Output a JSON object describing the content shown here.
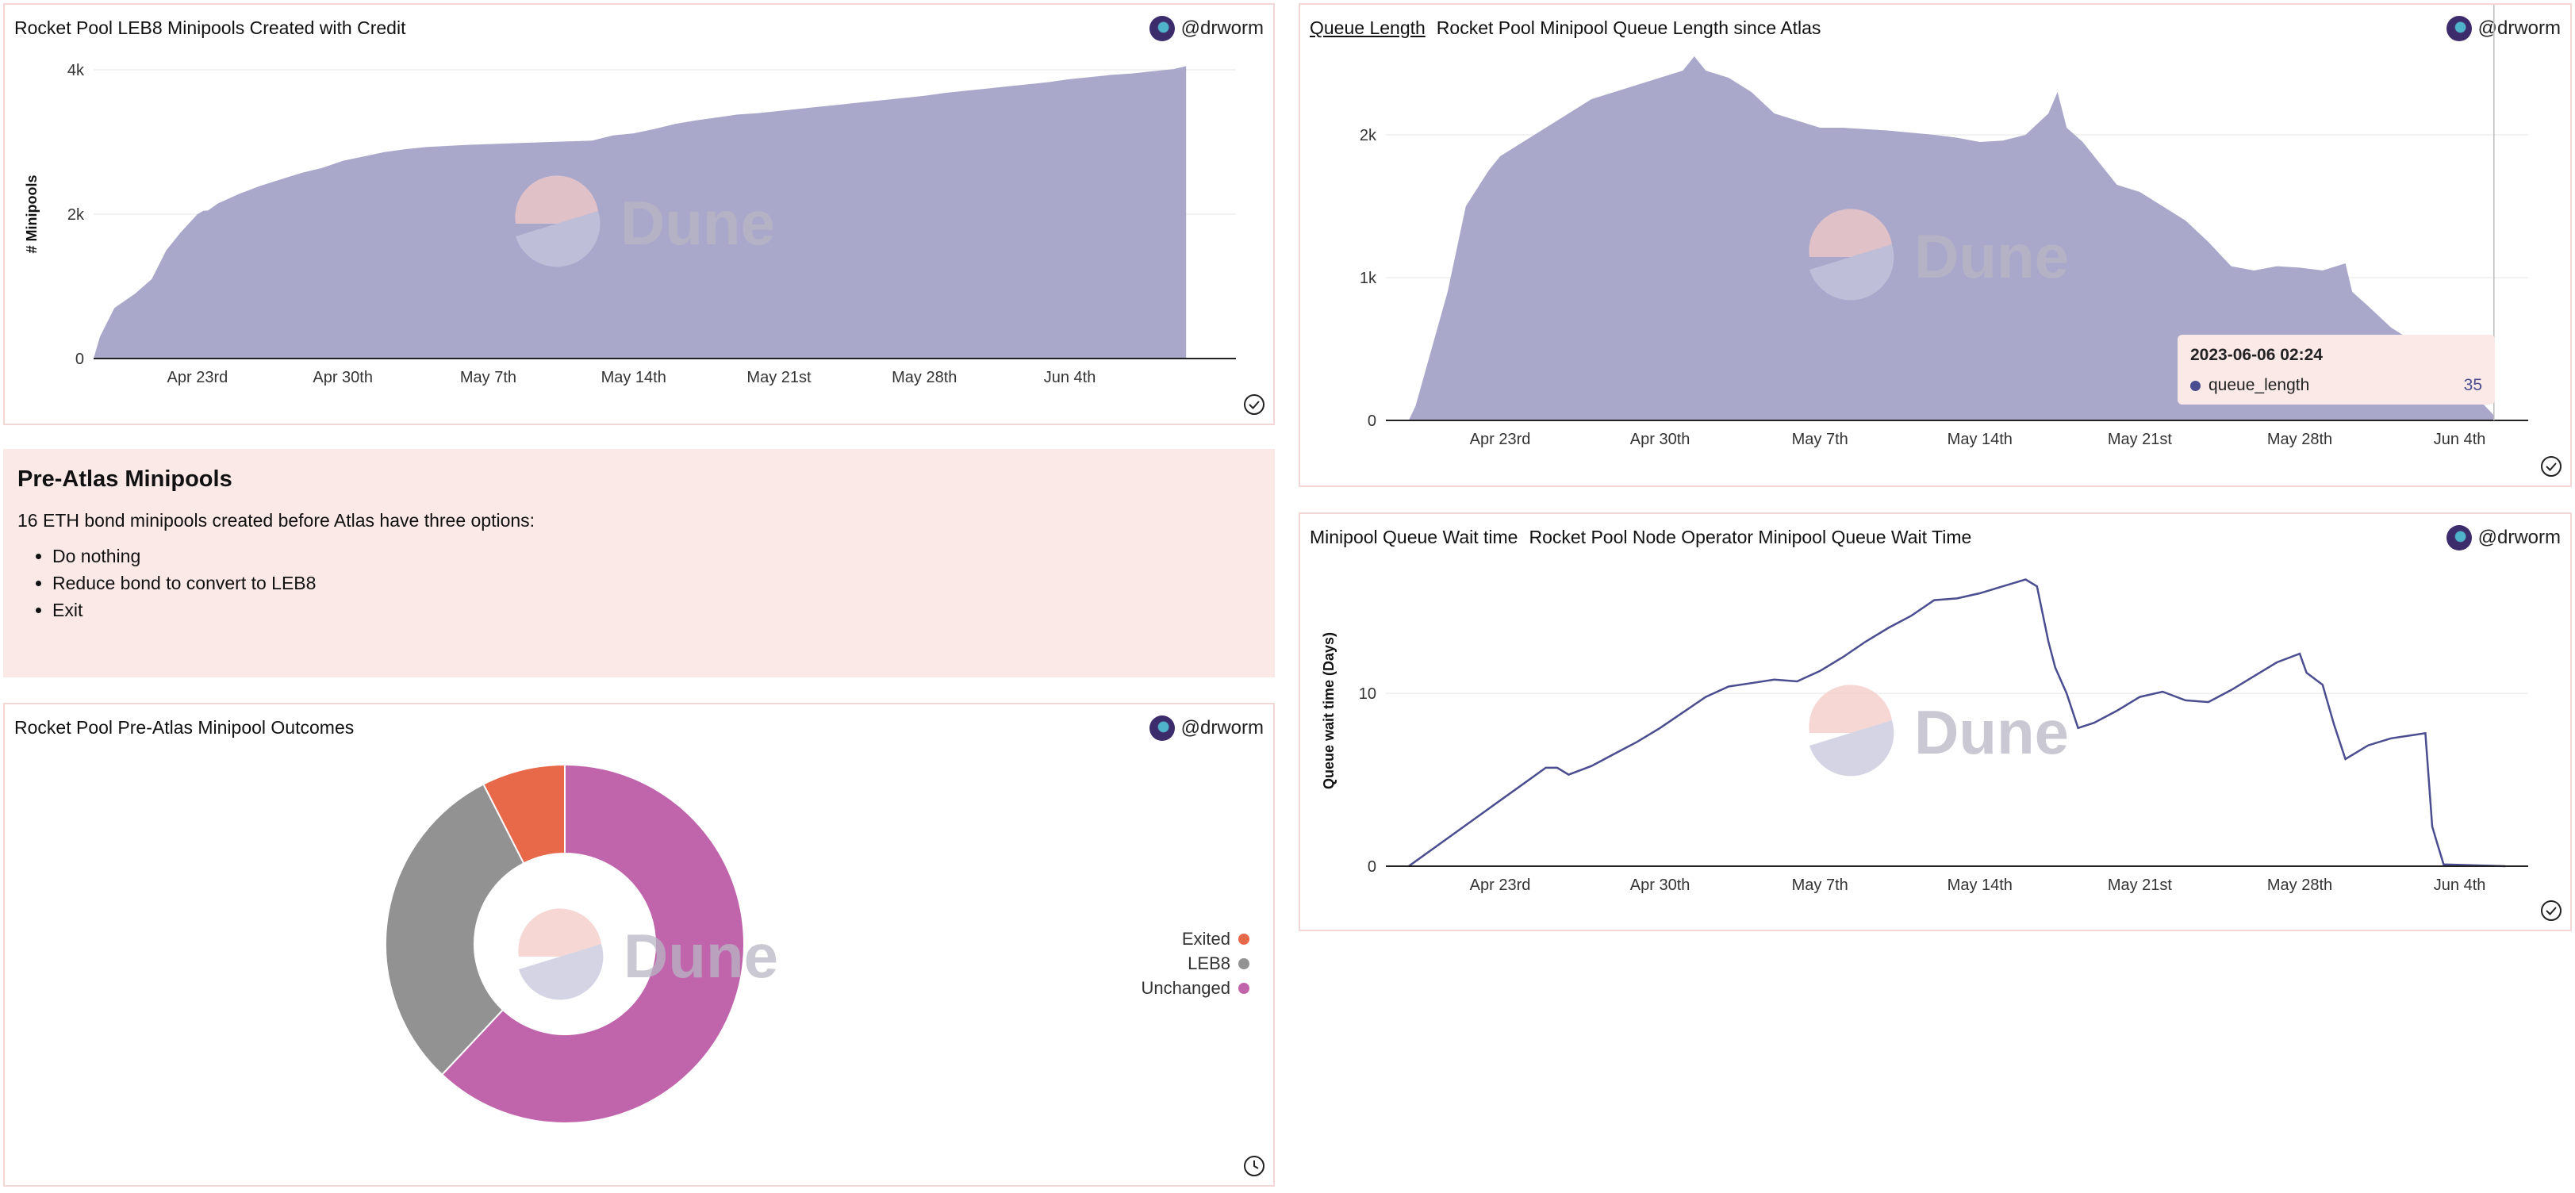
{
  "colors": {
    "area": "#a9a8cb",
    "line": "#4a4d8f",
    "tooltip_bg": "#fbe9e8",
    "tooltip_dot": "#4a4d8f",
    "exited": "#e8694a",
    "leb8": "#929292",
    "unchanged": "#c064ac",
    "watermark_text": "#b9b6c3"
  },
  "watermark": "Dune",
  "cards": {
    "leb8": {
      "title": "Rocket Pool LEB8 Minipools Created with Credit",
      "author": "@drworm",
      "status_icon": "check-circle-icon"
    },
    "queue_length": {
      "link_title": "Queue Length",
      "title": "Rocket Pool Minipool Queue Length since Atlas",
      "author": "@drworm",
      "status_icon": "check-circle-icon"
    },
    "wait_time": {
      "link_title": "Minipool Queue Wait time",
      "title": "Rocket Pool Node Operator Minipool Queue Wait Time",
      "author": "@drworm",
      "status_icon": "check-circle-icon"
    },
    "outcomes": {
      "title": "Rocket Pool Pre-Atlas Minipool Outcomes",
      "author": "@drworm",
      "status_icon": "clock-icon"
    }
  },
  "note": {
    "heading": "Pre-Atlas Minipools",
    "text": "16 ETH bond minipools created before Atlas have three options:",
    "items": [
      "Do nothing",
      "Reduce bond to convert to LEB8",
      "Exit"
    ]
  },
  "tooltip": {
    "date": "2023-06-06 02:24",
    "series": "queue_length",
    "value": "35"
  },
  "chart_data": [
    {
      "id": "leb8",
      "type": "area",
      "title": "Rocket Pool LEB8 Minipools Created with Credit",
      "ylabel": "# Minipools",
      "ylim": [
        0,
        4000
      ],
      "yticks": [
        {
          "v": 0,
          "label": "0"
        },
        {
          "v": 2000,
          "label": "2k"
        },
        {
          "v": 4000,
          "label": "4k"
        }
      ],
      "xlim": [
        0,
        55
      ],
      "xticks": [
        {
          "v": 5,
          "label": "Apr 23rd"
        },
        {
          "v": 12,
          "label": "Apr 30th"
        },
        {
          "v": 19,
          "label": "May 7th"
        },
        {
          "v": 26,
          "label": "May 14th"
        },
        {
          "v": 33,
          "label": "May 21st"
        },
        {
          "v": 40,
          "label": "May 28th"
        },
        {
          "v": 47,
          "label": "Jun 4th"
        }
      ],
      "points": [
        [
          0,
          0
        ],
        [
          0.3,
          300
        ],
        [
          1,
          700
        ],
        [
          2,
          900
        ],
        [
          2.8,
          1100
        ],
        [
          3.5,
          1500
        ],
        [
          4.2,
          1750
        ],
        [
          5,
          2000
        ],
        [
          5.3,
          2050
        ],
        [
          5.5,
          2050
        ],
        [
          6,
          2150
        ],
        [
          7,
          2280
        ],
        [
          8,
          2390
        ],
        [
          9,
          2480
        ],
        [
          10,
          2570
        ],
        [
          11,
          2640
        ],
        [
          12,
          2740
        ],
        [
          13,
          2800
        ],
        [
          14,
          2860
        ],
        [
          15,
          2900
        ],
        [
          16,
          2930
        ],
        [
          18,
          2960
        ],
        [
          20,
          2980
        ],
        [
          22,
          3000
        ],
        [
          24,
          3020
        ],
        [
          25,
          3090
        ],
        [
          26,
          3120
        ],
        [
          27,
          3180
        ],
        [
          28,
          3250
        ],
        [
          29,
          3300
        ],
        [
          30,
          3340
        ],
        [
          31,
          3380
        ],
        [
          32,
          3400
        ],
        [
          33,
          3430
        ],
        [
          34,
          3460
        ],
        [
          35,
          3490
        ],
        [
          36,
          3520
        ],
        [
          37,
          3550
        ],
        [
          38,
          3580
        ],
        [
          39,
          3610
        ],
        [
          40,
          3640
        ],
        [
          41,
          3680
        ],
        [
          42,
          3710
        ],
        [
          43,
          3740
        ],
        [
          44,
          3770
        ],
        [
          45,
          3800
        ],
        [
          46,
          3830
        ],
        [
          47,
          3870
        ],
        [
          48,
          3900
        ],
        [
          49,
          3930
        ],
        [
          50,
          3950
        ],
        [
          51,
          3980
        ],
        [
          52,
          4010
        ],
        [
          52.6,
          4050
        ],
        [
          52.6,
          0
        ]
      ],
      "xticks_note": ""
    },
    {
      "id": "queue_length",
      "type": "area",
      "title": "Rocket Pool Minipool Queue Length since Atlas",
      "ylabel": "",
      "series": [
        {
          "name": "queue_length"
        }
      ],
      "ylim": [
        0,
        2600
      ],
      "yticks": [
        {
          "v": 0,
          "label": "0"
        },
        {
          "v": 1000,
          "label": "1k"
        },
        {
          "v": 2000,
          "label": "2k"
        }
      ],
      "xlim": [
        0,
        50
      ],
      "xticks": [
        {
          "v": 5,
          "label": "Apr 23rd"
        },
        {
          "v": 12,
          "label": "Apr 30th"
        },
        {
          "v": 19,
          "label": "May 7th"
        },
        {
          "v": 26,
          "label": "May 14th"
        },
        {
          "v": 33,
          "label": "May 21st"
        },
        {
          "v": 40,
          "label": "May 28th"
        },
        {
          "v": 47,
          "label": "Jun 4th"
        }
      ],
      "points": [
        [
          1,
          0
        ],
        [
          1.3,
          100
        ],
        [
          2,
          500
        ],
        [
          2.7,
          900
        ],
        [
          3.5,
          1500
        ],
        [
          4.5,
          1750
        ],
        [
          5,
          1850
        ],
        [
          6,
          1950
        ],
        [
          7,
          2050
        ],
        [
          8,
          2150
        ],
        [
          9,
          2250
        ],
        [
          10,
          2300
        ],
        [
          11,
          2350
        ],
        [
          12,
          2400
        ],
        [
          13,
          2450
        ],
        [
          13.5,
          2550
        ],
        [
          14,
          2450
        ],
        [
          15,
          2400
        ],
        [
          16,
          2300
        ],
        [
          17,
          2150
        ],
        [
          18,
          2100
        ],
        [
          19,
          2050
        ],
        [
          20,
          2050
        ],
        [
          22,
          2030
        ],
        [
          24,
          2000
        ],
        [
          25,
          1980
        ],
        [
          26,
          1950
        ],
        [
          27,
          1960
        ],
        [
          28,
          2000
        ],
        [
          29,
          2150
        ],
        [
          29.4,
          2300
        ],
        [
          29.8,
          2050
        ],
        [
          30.5,
          1950
        ],
        [
          31,
          1850
        ],
        [
          32,
          1650
        ],
        [
          33,
          1600
        ],
        [
          34,
          1500
        ],
        [
          35,
          1400
        ],
        [
          36,
          1250
        ],
        [
          37,
          1080
        ],
        [
          38,
          1050
        ],
        [
          39,
          1080
        ],
        [
          40,
          1070
        ],
        [
          41,
          1050
        ],
        [
          42,
          1100
        ],
        [
          42.3,
          900
        ],
        [
          43,
          800
        ],
        [
          44,
          650
        ],
        [
          45,
          550
        ],
        [
          46,
          350
        ],
        [
          47,
          200
        ],
        [
          48,
          120
        ],
        [
          48.5,
          35
        ],
        [
          48.5,
          0
        ]
      ],
      "annotation": {
        "x": 48.5,
        "date": "2023-06-06 02:24",
        "value": 35
      }
    },
    {
      "id": "wait_time",
      "type": "line",
      "title": "Rocket Pool Node Operator Minipool Queue Wait Time",
      "ylabel": "Queue wait time (Days)",
      "ylim": [
        0,
        18
      ],
      "yticks": [
        {
          "v": 0,
          "label": "0"
        },
        {
          "v": 10,
          "label": "10"
        }
      ],
      "xlim": [
        0,
        50
      ],
      "xticks": [
        {
          "v": 5,
          "label": "Apr 23rd"
        },
        {
          "v": 12,
          "label": "Apr 30th"
        },
        {
          "v": 19,
          "label": "May 7th"
        },
        {
          "v": 26,
          "label": "May 14th"
        },
        {
          "v": 33,
          "label": "May 21st"
        },
        {
          "v": 40,
          "label": "May 28th"
        },
        {
          "v": 47,
          "label": "Jun 4th"
        }
      ],
      "points": [
        [
          1,
          0
        ],
        [
          3,
          1.9
        ],
        [
          5,
          3.8
        ],
        [
          7,
          5.7
        ],
        [
          7.5,
          5.7
        ],
        [
          8,
          5.3
        ],
        [
          9,
          5.8
        ],
        [
          10,
          6.5
        ],
        [
          11,
          7.2
        ],
        [
          12,
          8
        ],
        [
          13,
          8.9
        ],
        [
          14,
          9.8
        ],
        [
          15,
          10.4
        ],
        [
          16,
          10.6
        ],
        [
          17,
          10.8
        ],
        [
          18,
          10.7
        ],
        [
          19,
          11.3
        ],
        [
          20,
          12.1
        ],
        [
          21,
          13
        ],
        [
          22,
          13.8
        ],
        [
          23,
          14.5
        ],
        [
          24,
          15.4
        ],
        [
          25,
          15.5
        ],
        [
          26,
          15.8
        ],
        [
          27,
          16.2
        ],
        [
          28,
          16.6
        ],
        [
          28.5,
          16.2
        ],
        [
          29,
          13
        ],
        [
          29.3,
          11.5
        ],
        [
          29.8,
          10
        ],
        [
          30.3,
          8
        ],
        [
          31,
          8.3
        ],
        [
          32,
          9
        ],
        [
          33,
          9.8
        ],
        [
          34,
          10.1
        ],
        [
          35,
          9.6
        ],
        [
          36,
          9.5
        ],
        [
          37,
          10.2
        ],
        [
          38,
          11
        ],
        [
          39,
          11.8
        ],
        [
          40,
          12.3
        ],
        [
          40.3,
          11.2
        ],
        [
          41,
          10.5
        ],
        [
          41.5,
          8.2
        ],
        [
          42,
          6.2
        ],
        [
          43,
          7
        ],
        [
          44,
          7.4
        ],
        [
          45,
          7.6
        ],
        [
          45.5,
          7.7
        ],
        [
          45.8,
          2.3
        ],
        [
          46,
          1.4
        ],
        [
          46.3,
          0.1
        ],
        [
          49,
          0
        ]
      ]
    },
    {
      "id": "outcomes",
      "type": "pie",
      "title": "Rocket Pool Pre-Atlas Minipool Outcomes",
      "slices": [
        {
          "name": "Unchanged",
          "value": 62
        },
        {
          "name": "LEB8",
          "value": 30.5
        },
        {
          "name": "Exited",
          "value": 7.5
        }
      ],
      "legend": [
        "Exited",
        "LEB8",
        "Unchanged"
      ],
      "legend_position": "right"
    }
  ]
}
